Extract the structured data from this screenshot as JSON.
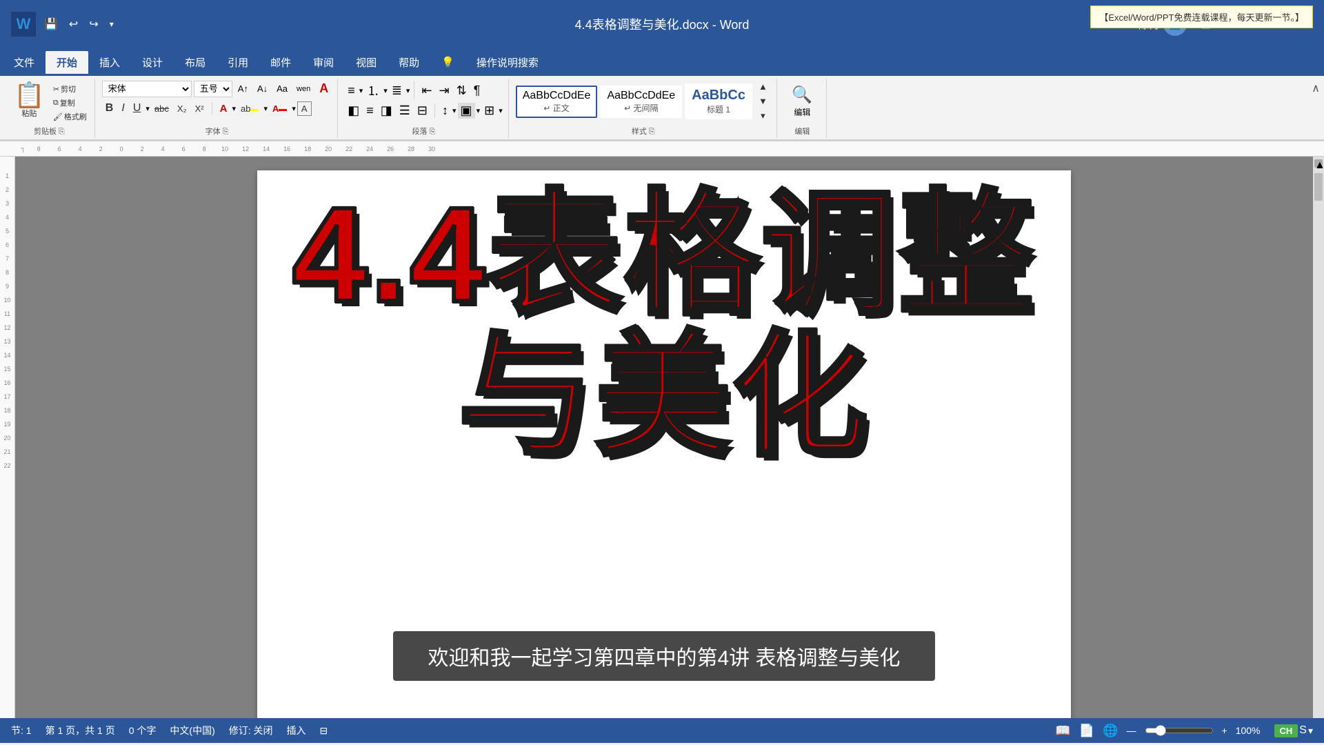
{
  "titlebar": {
    "filename": "4.4表格调整与美化.docx",
    "separator": " - ",
    "appname": "Word",
    "user": "陈冉",
    "tooltip": "【Excel/Word/PPT免费连载课程，每天更新一节。】"
  },
  "window_controls": {
    "minimize": "—",
    "maximize": "□",
    "close": "✕"
  },
  "quick_access": {
    "save": "💾",
    "undo": "↩",
    "redo": "↪",
    "more": "▾"
  },
  "menu_tabs": [
    {
      "label": "文件",
      "active": false
    },
    {
      "label": "开始",
      "active": true
    },
    {
      "label": "插入",
      "active": false
    },
    {
      "label": "设计",
      "active": false
    },
    {
      "label": "布局",
      "active": false
    },
    {
      "label": "引用",
      "active": false
    },
    {
      "label": "邮件",
      "active": false
    },
    {
      "label": "审阅",
      "active": false
    },
    {
      "label": "视图",
      "active": false
    },
    {
      "label": "帮助",
      "active": false
    },
    {
      "label": "💡",
      "active": false
    },
    {
      "label": "操作说明搜索",
      "active": false
    }
  ],
  "ribbon": {
    "groups": [
      {
        "label": "剪贴板"
      },
      {
        "label": "字体"
      },
      {
        "label": "段落"
      },
      {
        "label": "样式"
      },
      {
        "label": "编辑"
      }
    ],
    "font": {
      "name": "宋体",
      "size": "五号"
    },
    "styles": [
      {
        "name": "正文",
        "preview": "AaBbCcDdEe",
        "active": true
      },
      {
        "name": "无间隔",
        "preview": "AaBbCcDdEe",
        "active": false
      },
      {
        "name": "标题 1",
        "preview": "AaBbCc",
        "active": false,
        "bold": true
      }
    ]
  },
  "document": {
    "title_line1": "4.4表格调整",
    "title_line2": "与美化",
    "subtitle": "欢迎和我一起学习第四章中的第4讲 表格调整与美化"
  },
  "statusbar": {
    "section": "节: 1",
    "page": "第 1 页，共 1 页",
    "words": "0 个字",
    "language": "中文(中国)",
    "track": "修订: 关闭",
    "insert": "插入",
    "zoom": "100%",
    "lang_badge": "CH"
  },
  "ruler": {
    "marks": [
      "8",
      "6",
      "4",
      "2",
      "0",
      "2",
      "4",
      "6",
      "8",
      "10",
      "12",
      "14",
      "16",
      "18",
      "20",
      "22",
      "24",
      "26",
      "28",
      "30"
    ]
  }
}
